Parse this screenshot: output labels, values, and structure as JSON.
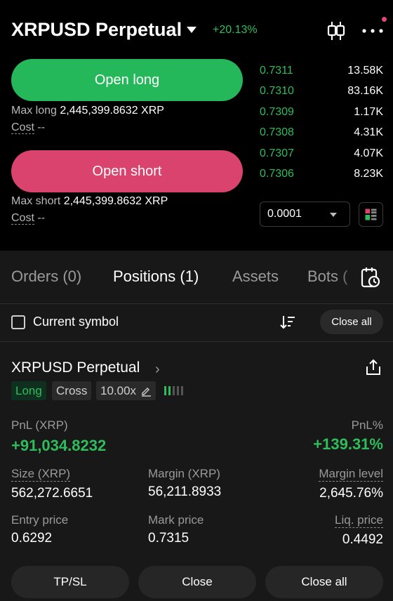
{
  "header": {
    "title": "XRPUSD Perpetual",
    "change": "+20.13%",
    "colors": {
      "up": "#2ebd5a",
      "down": "#d9436d",
      "notice_dot": "#e0457b"
    },
    "icons": [
      "chevron-down-icon",
      "candlestick-icon",
      "more-icon"
    ]
  },
  "trade": {
    "open_long": "Open long",
    "max_long_label": "Max long",
    "max_long_value": "2,445,399.8632 XRP",
    "cost_label": "Cost",
    "cost_value": "--",
    "open_short": "Open short",
    "max_short_label": "Max short",
    "max_short_value": "2,445,399.8632 XRP",
    "cost2_label": "Cost",
    "cost2_value": "--"
  },
  "orderbook": {
    "rows": [
      {
        "price": "0.7311",
        "qty": "13.58K"
      },
      {
        "price": "0.7310",
        "qty": "83.16K"
      },
      {
        "price": "0.7309",
        "qty": "1.17K"
      },
      {
        "price": "0.7308",
        "qty": "4.31K"
      },
      {
        "price": "0.7307",
        "qty": "4.07K"
      },
      {
        "price": "0.7306",
        "qty": "8.23K"
      }
    ],
    "precision": "0.0001"
  },
  "tabs": {
    "orders": "Orders (0)",
    "positions": "Positions (1)",
    "assets": "Assets",
    "bots": "Bots ("
  },
  "filter": {
    "current_symbol": "Current symbol",
    "close_all": "Close all"
  },
  "position": {
    "symbol": "XRPUSD Perpetual",
    "side": "Long",
    "margin_mode": "Cross",
    "leverage": "10.00x",
    "pnl_label": "PnL (XRP)",
    "pnl_value": "+91,034.8232",
    "pnl_pct_label": "PnL%",
    "pnl_pct_value": "+139.31%",
    "size_label": "Size (XRP)",
    "size_value": "562,272.6651",
    "margin_label": "Margin (XRP)",
    "margin_value": "56,211.8933",
    "margin_level_label": "Margin level",
    "margin_level_value": "2,645.76%",
    "entry_label": "Entry price",
    "entry_value": "0.6292",
    "mark_label": "Mark price",
    "mark_value": "0.7315",
    "liq_label": "Liq. price",
    "liq_value": "0.4492"
  },
  "actions": {
    "tpsl": "TP/SL",
    "close": "Close",
    "close_all": "Close all"
  }
}
